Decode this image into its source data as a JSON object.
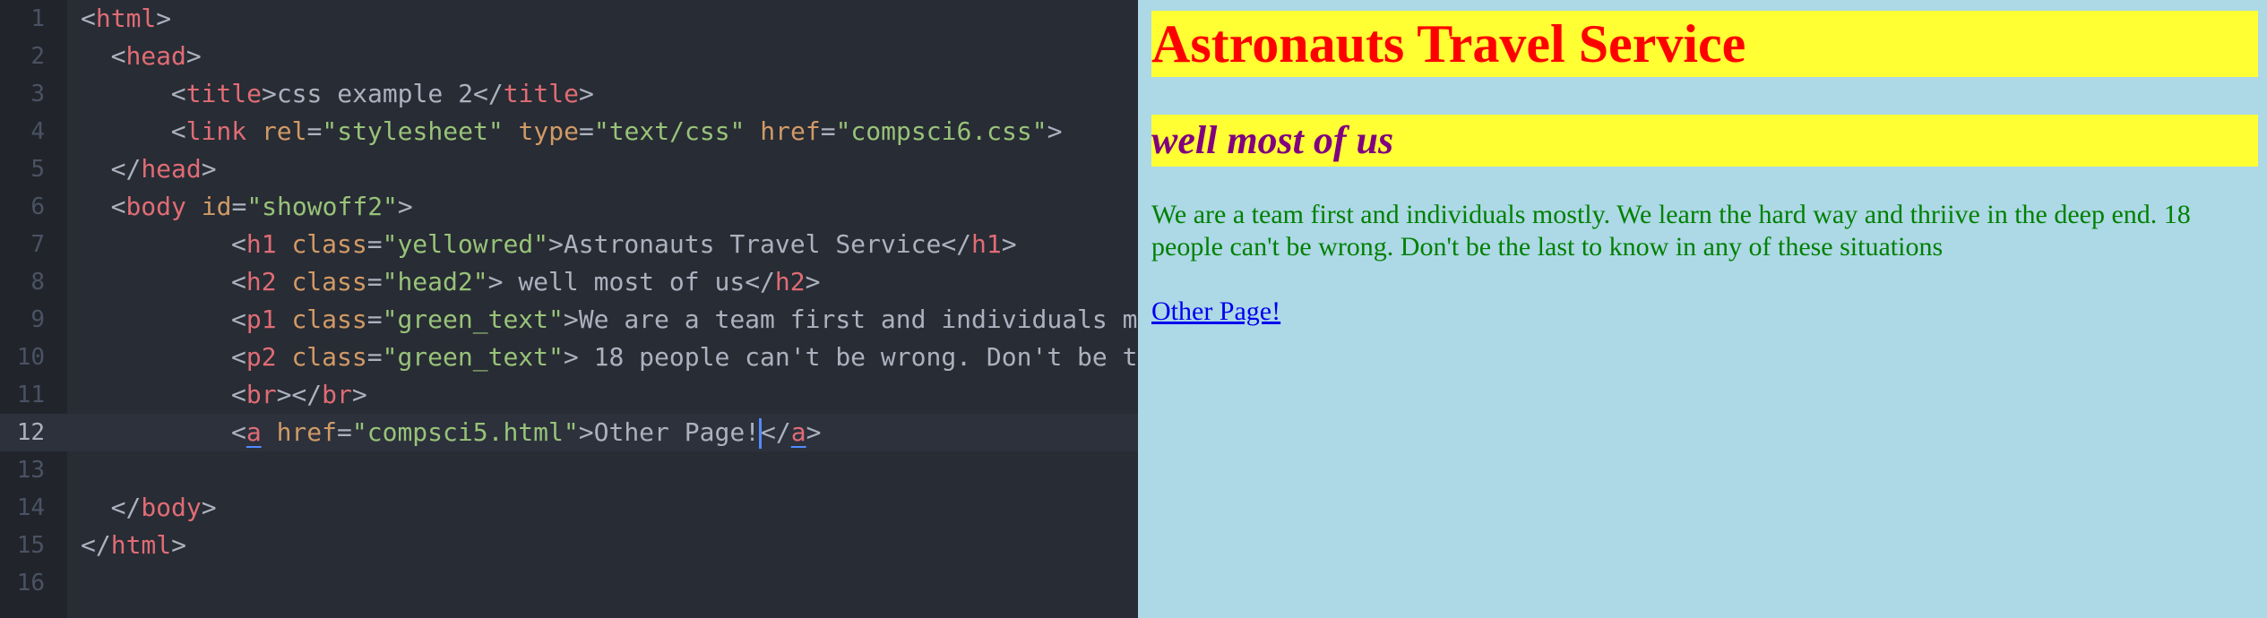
{
  "editor": {
    "line_numbers": [
      "1",
      "2",
      "3",
      "4",
      "5",
      "6",
      "7",
      "8",
      "9",
      "10",
      "11",
      "12",
      "13",
      "14",
      "15",
      "16"
    ],
    "lines": [
      {
        "indent": "",
        "tokens": [
          [
            "p",
            "<"
          ],
          [
            "tag",
            "html"
          ],
          [
            "p",
            ">"
          ]
        ]
      },
      {
        "indent": "  ",
        "tokens": [
          [
            "p",
            "<"
          ],
          [
            "tag",
            "head"
          ],
          [
            "p",
            ">"
          ]
        ]
      },
      {
        "indent": "      ",
        "tokens": [
          [
            "p",
            "<"
          ],
          [
            "tag",
            "title"
          ],
          [
            "p",
            ">"
          ],
          [
            "t",
            "css example 2"
          ],
          [
            "p",
            "</"
          ],
          [
            "tag",
            "title"
          ],
          [
            "p",
            ">"
          ]
        ]
      },
      {
        "indent": "      ",
        "tokens": [
          [
            "p",
            "<"
          ],
          [
            "tag",
            "link"
          ],
          [
            "p",
            " "
          ],
          [
            "attr",
            "rel"
          ],
          [
            "p",
            "="
          ],
          [
            "str",
            "\"stylesheet\""
          ],
          [
            "p",
            " "
          ],
          [
            "attr",
            "type"
          ],
          [
            "p",
            "="
          ],
          [
            "str",
            "\"text/css\""
          ],
          [
            "p",
            " "
          ],
          [
            "attr",
            "href"
          ],
          [
            "p",
            "="
          ],
          [
            "str",
            "\"compsci6.css\""
          ],
          [
            "p",
            ">"
          ]
        ]
      },
      {
        "indent": "  ",
        "tokens": [
          [
            "p",
            "</"
          ],
          [
            "tag",
            "head"
          ],
          [
            "p",
            ">"
          ]
        ]
      },
      {
        "indent": "  ",
        "tokens": [
          [
            "p",
            "<"
          ],
          [
            "tag",
            "body"
          ],
          [
            "p",
            " "
          ],
          [
            "attr",
            "id"
          ],
          [
            "p",
            "="
          ],
          [
            "str",
            "\"showoff2\""
          ],
          [
            "p",
            ">"
          ]
        ]
      },
      {
        "indent": "          ",
        "tokens": [
          [
            "p",
            "<"
          ],
          [
            "tag",
            "h1"
          ],
          [
            "p",
            " "
          ],
          [
            "attr",
            "class"
          ],
          [
            "p",
            "="
          ],
          [
            "str",
            "\"yellowred\""
          ],
          [
            "p",
            ">"
          ],
          [
            "t",
            "Astronauts Travel Service"
          ],
          [
            "p",
            "</"
          ],
          [
            "tag",
            "h1"
          ],
          [
            "p",
            ">"
          ]
        ]
      },
      {
        "indent": "          ",
        "tokens": [
          [
            "p",
            "<"
          ],
          [
            "tag",
            "h2"
          ],
          [
            "p",
            " "
          ],
          [
            "attr",
            "class"
          ],
          [
            "p",
            "="
          ],
          [
            "str",
            "\"head2\""
          ],
          [
            "p",
            ">"
          ],
          [
            "t",
            " well most of us"
          ],
          [
            "p",
            "</"
          ],
          [
            "tag",
            "h2"
          ],
          [
            "p",
            ">"
          ]
        ]
      },
      {
        "indent": "          ",
        "tokens": [
          [
            "p",
            "<"
          ],
          [
            "tag",
            "p1"
          ],
          [
            "p",
            " "
          ],
          [
            "attr",
            "class"
          ],
          [
            "p",
            "="
          ],
          [
            "str",
            "\"green_text\""
          ],
          [
            "p",
            ">"
          ],
          [
            "t",
            "We are a team first and individuals m"
          ]
        ]
      },
      {
        "indent": "          ",
        "tokens": [
          [
            "p",
            "<"
          ],
          [
            "tag",
            "p2"
          ],
          [
            "p",
            " "
          ],
          [
            "attr",
            "class"
          ],
          [
            "p",
            "="
          ],
          [
            "str",
            "\"green_text\""
          ],
          [
            "p",
            ">"
          ],
          [
            "t",
            " 18 people can't be wrong. Don't be t"
          ]
        ]
      },
      {
        "indent": "          ",
        "tokens": [
          [
            "p",
            "<"
          ],
          [
            "tag",
            "br"
          ],
          [
            "p",
            "></"
          ],
          [
            "tag",
            "br"
          ],
          [
            "p",
            ">"
          ]
        ]
      },
      {
        "indent": "          ",
        "active": true,
        "tokens": [
          [
            "p",
            "<"
          ],
          [
            "tagu",
            "a"
          ],
          [
            "p",
            " "
          ],
          [
            "attr",
            "href"
          ],
          [
            "p",
            "="
          ],
          [
            "str",
            "\"compsci5.html\""
          ],
          [
            "p",
            ">"
          ],
          [
            "t",
            "Other Page!"
          ],
          [
            "cursor",
            ""
          ],
          [
            "p",
            "</"
          ],
          [
            "tagu",
            "a"
          ],
          [
            "p",
            ">"
          ]
        ]
      },
      {
        "indent": "",
        "tokens": []
      },
      {
        "indent": "  ",
        "tokens": [
          [
            "p",
            "</"
          ],
          [
            "tag",
            "body"
          ],
          [
            "p",
            ">"
          ]
        ]
      },
      {
        "indent": "",
        "tokens": [
          [
            "p",
            "</"
          ],
          [
            "tag",
            "html"
          ],
          [
            "p",
            ">"
          ]
        ]
      },
      {
        "indent": "",
        "tokens": []
      }
    ]
  },
  "preview": {
    "h1": "Astronauts Travel Service",
    "h2": "well most of us",
    "paragraph": "We are a team first and individuals mostly. We learn the hard way and thriive in the deep end. 18 people can't be wrong. Don't be the last to know in any of these situations",
    "link": "Other Page!"
  },
  "colors": {
    "editor_bg": "#282c34",
    "tag": "#e06c75",
    "attr": "#d19a66",
    "string": "#98c379",
    "text": "#abb2bf",
    "preview_bg": "#add8e6",
    "highlight_bg": "#ffff33",
    "h1_color": "#ff0000",
    "h2_color": "#800080",
    "para_color": "#008000",
    "link_color": "#0000ee"
  }
}
